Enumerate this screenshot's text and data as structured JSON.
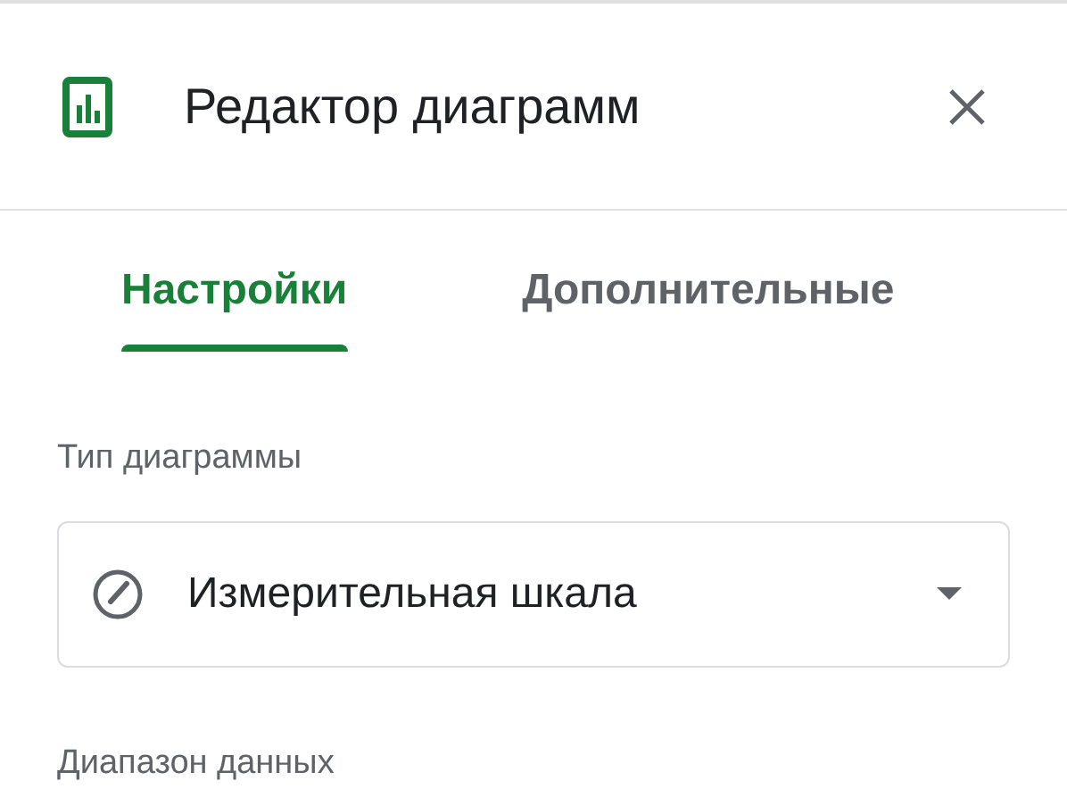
{
  "header": {
    "title": "Редактор диаграмм"
  },
  "tabs": [
    {
      "label": "Настройки",
      "selected": true
    },
    {
      "label": "Дополнительные",
      "selected": false
    }
  ],
  "chart_type": {
    "label": "Тип диаграммы",
    "value": "Измерительная шкала"
  },
  "data_range": {
    "label": "Диапазон данных"
  }
}
